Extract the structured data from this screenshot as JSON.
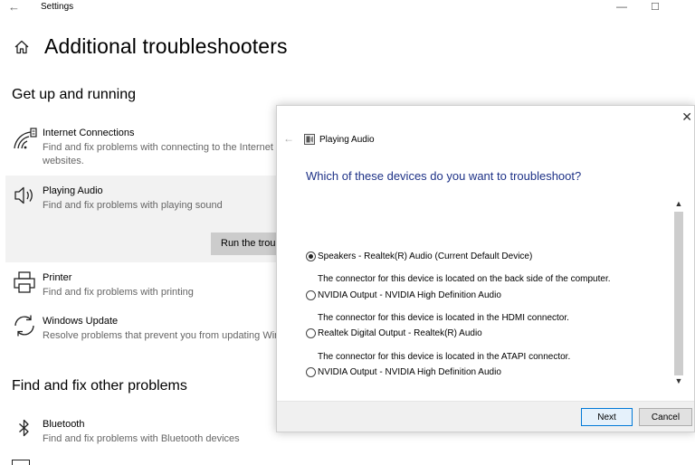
{
  "window": {
    "title": "Settings",
    "back_glyph": "←",
    "minimize_glyph": "—",
    "maximize_glyph": "☐"
  },
  "page": {
    "title": "Additional troubleshooters",
    "icon": "home-icon"
  },
  "sections": {
    "get_up_running": "Get up and running",
    "find_fix_other": "Find and fix other problems"
  },
  "items": [
    {
      "name": "Internet Connections",
      "desc_line1": "Find and fix problems with connecting to the Internet or to",
      "desc_line2": "websites.",
      "icon": "wifi-icon"
    },
    {
      "name": "Playing Audio",
      "desc_line1": "Find and fix problems with playing sound",
      "icon": "speaker-icon",
      "selected": true
    },
    {
      "name": "Printer",
      "desc_line1": "Find and fix problems with printing",
      "icon": "printer-icon"
    },
    {
      "name": "Windows Update",
      "desc_line1": "Resolve problems that prevent you from updating Windows.",
      "icon": "refresh-icon"
    },
    {
      "name": "Bluetooth",
      "desc_line1": "Find and fix problems with Bluetooth devices",
      "icon": "bluetooth-icon"
    }
  ],
  "run_button": "Run the troubleshooter",
  "dialog": {
    "close_glyph": "✕",
    "back_glyph": "←",
    "app_title": "Playing Audio",
    "question": "Which of these devices do you want to troubleshoot?",
    "options": [
      {
        "label": "Speakers - Realtek(R) Audio (Current Default Device)",
        "desc": "The connector for this device is located on the back side of the computer.",
        "selected": true
      },
      {
        "label": "NVIDIA Output - NVIDIA High Definition Audio",
        "desc": "The connector for this device is located in the HDMI connector.",
        "selected": false
      },
      {
        "label": "Realtek Digital Output - Realtek(R) Audio",
        "desc": "The connector for this device is located in the ATAPI connector.",
        "selected": false
      },
      {
        "label": "NVIDIA Output - NVIDIA High Definition Audio",
        "selected": false
      }
    ],
    "next": "Next",
    "cancel": "Cancel"
  },
  "colors": {
    "question_blue": "#1e3287",
    "selected_item_bg": "#f2f2f2",
    "run_button_bg": "#cccccc",
    "primary_border": "#0078d7"
  }
}
